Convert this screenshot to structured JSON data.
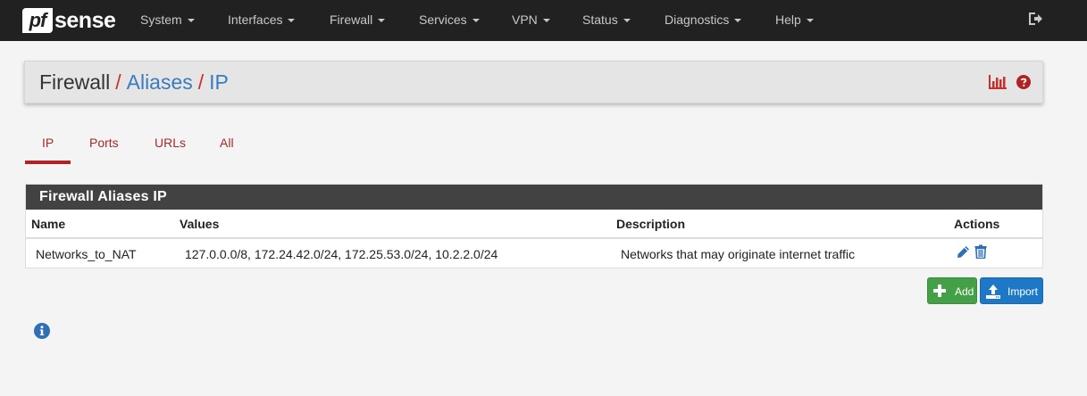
{
  "brand": {
    "pf": "pf",
    "sense": "sense"
  },
  "nav": {
    "items": [
      {
        "label": "System"
      },
      {
        "label": "Interfaces"
      },
      {
        "label": "Firewall"
      },
      {
        "label": "Services"
      },
      {
        "label": "VPN"
      },
      {
        "label": "Status"
      },
      {
        "label": "Diagnostics"
      },
      {
        "label": "Help"
      }
    ]
  },
  "breadcrumb": {
    "root": "Firewall",
    "sep": "/",
    "section": "Aliases",
    "page": "IP"
  },
  "tabs": [
    {
      "label": "IP",
      "active": true
    },
    {
      "label": "Ports",
      "active": false
    },
    {
      "label": "URLs",
      "active": false
    },
    {
      "label": "All",
      "active": false
    }
  ],
  "panel": {
    "title": "Firewall Aliases IP",
    "columns": [
      "Name",
      "Values",
      "Description",
      "Actions"
    ],
    "rows": [
      {
        "name": "Networks_to_NAT",
        "values": "127.0.0.0/8, 172.24.42.0/24, 172.25.53.0/24, 10.2.2.0/24",
        "description": "Networks that may originate internet traffic"
      }
    ]
  },
  "buttons": {
    "add": "Add",
    "import": "Import"
  },
  "colors": {
    "navbar": "#212121",
    "accent_red": "#b22222",
    "link_blue": "#3a7bbd",
    "add_green": "#43a047",
    "import_blue": "#1e78c8",
    "panel_heading": "#424242"
  },
  "icons": [
    "logout-icon",
    "chart-icon",
    "help-icon",
    "edit-icon",
    "trash-icon",
    "plus-icon",
    "upload-icon",
    "info-icon"
  ]
}
